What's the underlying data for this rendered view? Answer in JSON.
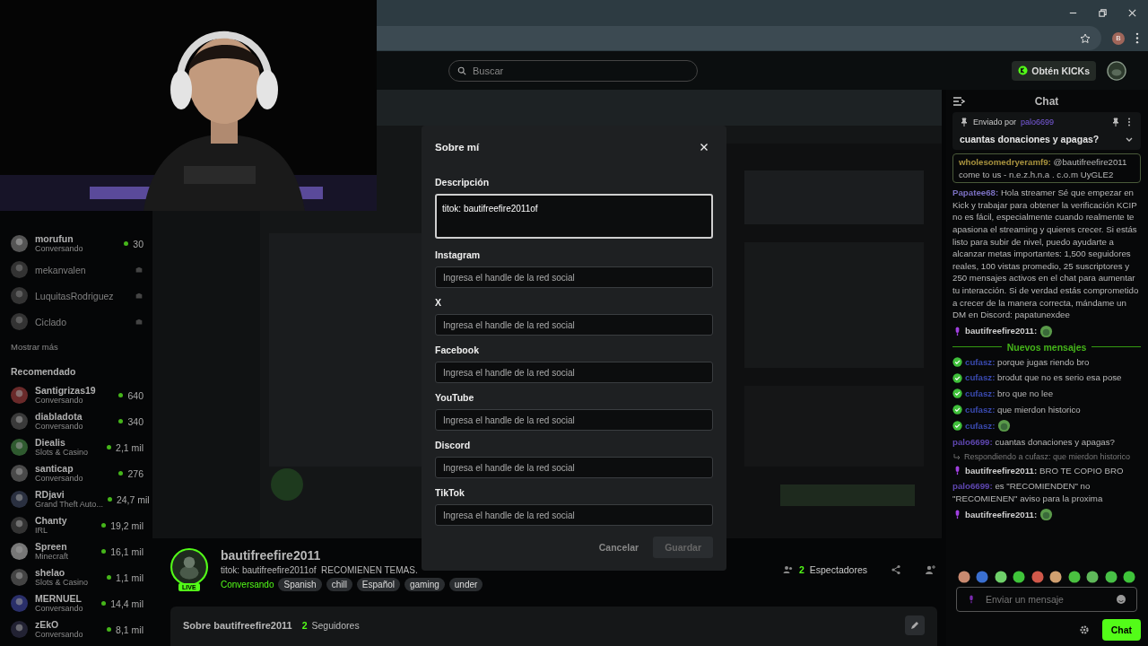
{
  "browser": {
    "profile_initial": "B"
  },
  "topbar": {
    "search": {
      "placeholder": "Buscar"
    },
    "kicks_button": "Obtén KICKs"
  },
  "sidebar": {
    "following": [
      {
        "name": "morufun",
        "subtitle": "Conversando",
        "viewers": "30",
        "live": true
      },
      {
        "name": "mekanvalen",
        "live": false
      },
      {
        "name": "LuquitasRodriguez",
        "live": false
      },
      {
        "name": "Ciclado",
        "live": false
      }
    ],
    "show_more": "Mostrar más",
    "recommended_title": "Recomendado",
    "recommended": [
      {
        "name": "Santigrizas19",
        "subtitle": "Conversando",
        "viewers": "640",
        "live": true
      },
      {
        "name": "diabladota",
        "subtitle": "Conversando",
        "viewers": "340",
        "live": true
      },
      {
        "name": "Diealis",
        "subtitle": "Slots & Casino",
        "viewers": "2,1 mil",
        "live": true
      },
      {
        "name": "santicap",
        "subtitle": "Conversando",
        "viewers": "276",
        "live": true
      },
      {
        "name": "RDjavi",
        "subtitle": "Grand Theft Auto...",
        "viewers": "24,7 mil",
        "live": true
      },
      {
        "name": "Chanty",
        "subtitle": "IRL",
        "viewers": "19,2 mil",
        "live": true
      },
      {
        "name": "Spreen",
        "subtitle": "Minecraft",
        "viewers": "16,1 mil",
        "live": true
      },
      {
        "name": "shelao",
        "subtitle": "Slots & Casino",
        "viewers": "1,1 mil",
        "live": true
      },
      {
        "name": "MERNUEL",
        "subtitle": "Conversando",
        "viewers": "14,4 mil",
        "live": true
      },
      {
        "name": "zEkO",
        "subtitle": "Conversando",
        "viewers": "8,1 mil",
        "live": true
      }
    ]
  },
  "channel": {
    "name": "bautifreefire2011",
    "live_badge": "LIVE",
    "title": "titok: bautifreefire2011of  RECOMIENEN TEMAS.",
    "category": "Conversando",
    "tags": [
      "Spanish",
      "chill",
      "Español",
      "gaming",
      "under"
    ],
    "viewers_count": "2",
    "viewers_label": "Espectadores"
  },
  "about": {
    "title": "Sobre bautifreefire2011",
    "followers_count": "2",
    "followers_label": "Seguidores"
  },
  "chat": {
    "title": "Chat",
    "pinned": {
      "label": "Enviado por",
      "user": "palo6699",
      "text": "cuantas donaciones y apagas?"
    },
    "messages": [
      {
        "kind": "highlighted",
        "user": "wholesomedryeramf9:",
        "color": "#a8923e",
        "text": "@bautifreefire2011 come to us - n.e.z.h.n.a . c.o.m UyGLE2"
      },
      {
        "kind": "text",
        "user": "Papatee68:",
        "color": "#7a6fc0",
        "text": "Hola streamer Sé que empezar en Kick y trabajar para obtener la verificación KCIP no es fácil, especialmente cuando realmente te apasiona el streaming y quieres crecer. Si estás listo para subir de nivel, puedo ayudarte a alcanzar metas importantes: 1,500 seguidores reales, 100 vistas promedio, 25 suscriptores y 250 mensajes activos en el chat para aumentar tu interacción. Si de verdad estás comprometido a crecer de la manera correcta, mándame un DM en Discord: papatunexdee"
      },
      {
        "kind": "text",
        "user": "bautifreefire2011:",
        "color": "#cfcfcf",
        "broadcaster": true,
        "emote": true
      },
      {
        "kind": "divider",
        "text": "Nuevos mensajes"
      },
      {
        "kind": "text",
        "user": "cufasz:",
        "color": "#3a4ab0",
        "verified": true,
        "text": "porque jugas riendo bro"
      },
      {
        "kind": "text",
        "user": "cufasz:",
        "color": "#3a4ab0",
        "verified": true,
        "text": "brodut que no es serio esa pose"
      },
      {
        "kind": "text",
        "user": "cufasz:",
        "color": "#3a4ab0",
        "verified": true,
        "text": "bro que no lee"
      },
      {
        "kind": "text",
        "user": "cufasz:",
        "color": "#3a4ab0",
        "verified": true,
        "text": "que mierdon historico"
      },
      {
        "kind": "text",
        "user": "cufasz:",
        "color": "#3a4ab0",
        "verified": true,
        "emote": true
      },
      {
        "kind": "text",
        "user": "palo6699:",
        "color": "#5e46b0",
        "text": "cuantas donaciones y apagas?"
      },
      {
        "kind": "reply",
        "text": "Respondiendo a cufasz: que mierdon historico"
      },
      {
        "kind": "text",
        "user": "bautifreefire2011:",
        "color": "#cfcfcf",
        "broadcaster": true,
        "text": "BRO TE COPIO BRO"
      },
      {
        "kind": "text",
        "user": "palo6699:",
        "color": "#5e46b0",
        "text": "es \"RECOMIENDEN\" no \"RECOMIENEN\" aviso para la proxima"
      },
      {
        "kind": "text",
        "user": "bautifreefire2011:",
        "color": "#cfcfcf",
        "broadcaster": true,
        "emote": true
      }
    ],
    "emotes": [
      {
        "color": "#c98a70"
      },
      {
        "color": "#3a6fd0"
      },
      {
        "color": "#6fd06a"
      },
      {
        "color": "#3fc43a"
      },
      {
        "color": "#d0584a"
      },
      {
        "color": "#d0a070"
      },
      {
        "color": "#4ac040"
      },
      {
        "color": "#5fb85a"
      },
      {
        "color": "#48c046"
      },
      {
        "color": "#3fc43a"
      }
    ],
    "input": {
      "placeholder": "Enviar un mensaje"
    },
    "send_button": "Chat"
  },
  "modal": {
    "title": "Sobre mí",
    "description": {
      "label": "Descripción",
      "value": "titok: bautifreefire2011of"
    },
    "fields": [
      {
        "label": "Instagram",
        "placeholder": "Ingresa el handle de la red social"
      },
      {
        "label": "X",
        "placeholder": "Ingresa el handle de la red social"
      },
      {
        "label": "Facebook",
        "placeholder": "Ingresa el handle de la red social"
      },
      {
        "label": "YouTube",
        "placeholder": "Ingresa el handle de la red social"
      },
      {
        "label": "Discord",
        "placeholder": "Ingresa el handle de la red social"
      },
      {
        "label": "TikTok",
        "placeholder": "Ingresa el handle de la red social"
      }
    ],
    "cancel_button": "Cancelar",
    "save_button": {
      "label": "Guardar",
      "disabled": true
    }
  }
}
